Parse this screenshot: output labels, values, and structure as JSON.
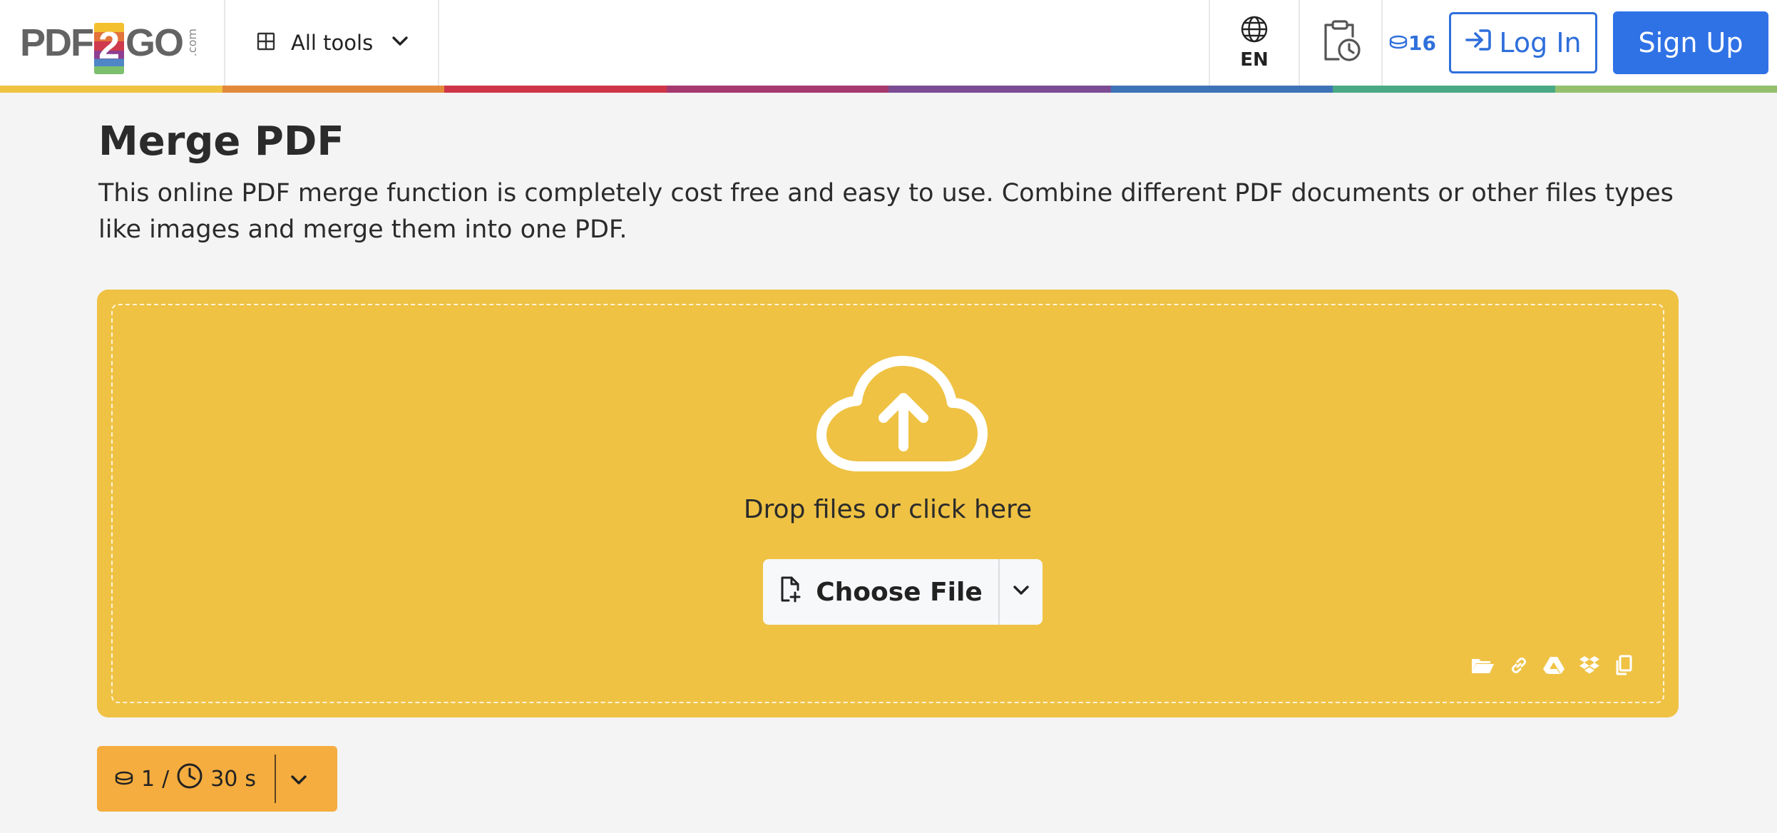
{
  "header": {
    "logo": {
      "left": "PDF",
      "middle": "2",
      "right": "GO",
      "suffix": ".com"
    },
    "all_tools_label": "All tools",
    "language_code": "EN",
    "credits_count": "16",
    "login_label": "Log In",
    "signup_label": "Sign Up"
  },
  "rainbow_colors": [
    "#f0c342",
    "#e3893a",
    "#cf3548",
    "#a6386e",
    "#7b4c94",
    "#3f73b8",
    "#4aa985",
    "#94c06e"
  ],
  "page": {
    "title": "Merge PDF",
    "description": "This online PDF merge function is completely cost free and easy to use. Combine different PDF documents or other files types like images and merge them into one PDF."
  },
  "dropzone": {
    "prompt": "Drop files or click here",
    "choose_file_label": "Choose File",
    "source_icons": [
      "folder-icon",
      "link-icon",
      "google-drive-icon",
      "dropbox-icon",
      "clipboard-icon"
    ]
  },
  "cost": {
    "credits": "1",
    "separator": "/",
    "time": "30",
    "time_unit": "s"
  },
  "colors": {
    "accent_blue": "#2f72e6",
    "dropzone_yellow": "#efc244",
    "cost_orange": "#f5ad3f"
  }
}
